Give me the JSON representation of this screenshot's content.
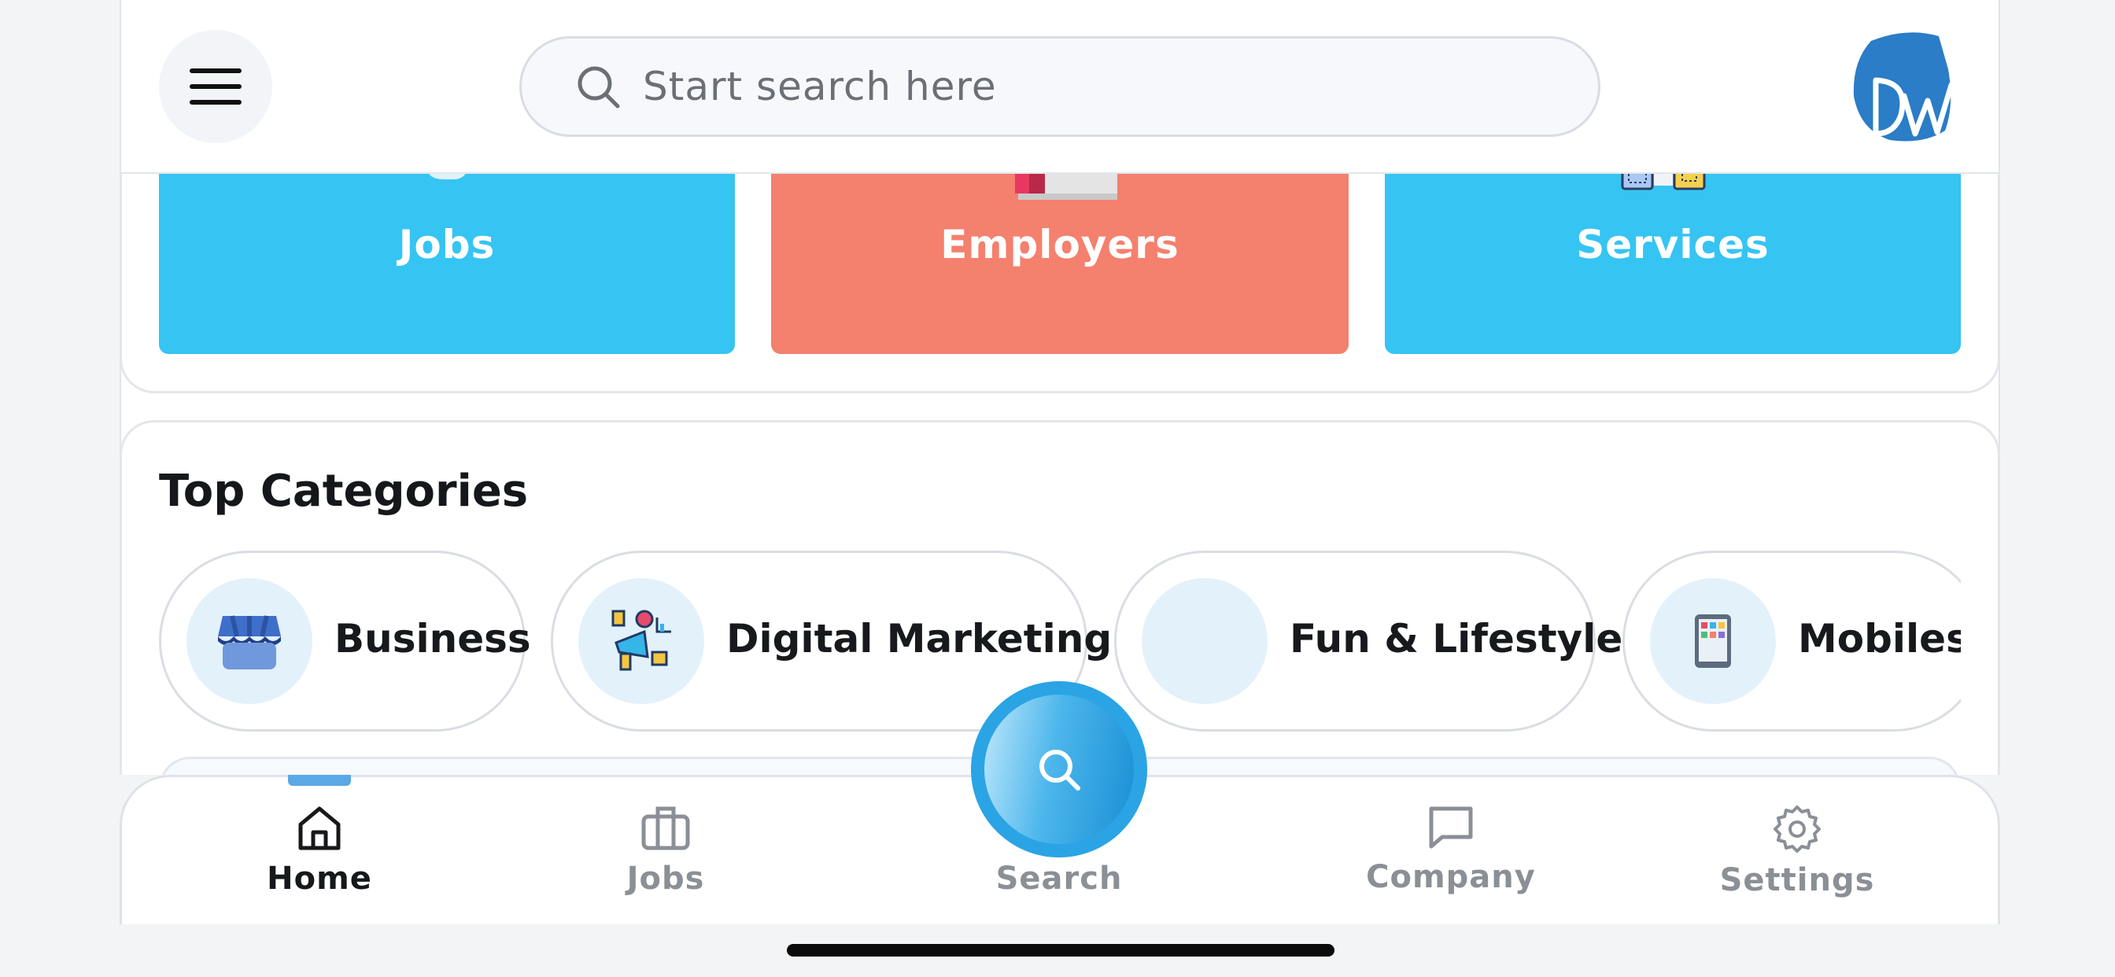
{
  "header": {
    "search_placeholder": "Start search here",
    "avatar_initials": "Dw"
  },
  "tiles": {
    "jobs_label": "Jobs",
    "employers_label": "Employers",
    "services_label": "Services"
  },
  "categories": {
    "title": "Top Categories",
    "items": [
      {
        "label": "Business",
        "icon": "store-icon"
      },
      {
        "label": "Digital Marketing",
        "icon": "marketing-icon"
      },
      {
        "label": "Fun & Lifestyle",
        "icon": "blank-icon"
      },
      {
        "label": "Mobiles",
        "icon": "phone-icon"
      }
    ]
  },
  "nav": {
    "home": "Home",
    "jobs": "Jobs",
    "search": "Search",
    "company": "Company",
    "settings": "Settings"
  },
  "colors": {
    "tile_blue": "#36c4f3",
    "tile_coral": "#f4806e",
    "accent": "#2aa4e4"
  }
}
